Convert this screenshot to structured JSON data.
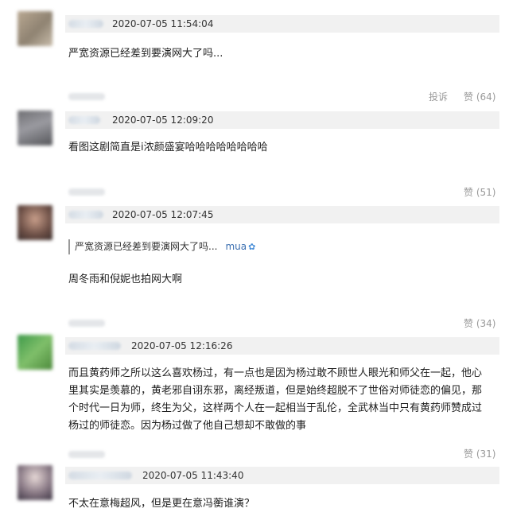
{
  "comments": [
    {
      "timestamp": "2020-07-05 11:54:04",
      "text": "严宽资源已经差到要演网大了吗...",
      "actions": {
        "report": "投诉",
        "like": "赞 (64)"
      }
    },
    {
      "timestamp": "2020-07-05 12:09:20",
      "text": "看图这剧简直是i浓颜盛宴哈哈哈哈哈哈哈哈",
      "actions": {
        "like": "赞 (51)"
      }
    },
    {
      "timestamp": "2020-07-05 12:07:45",
      "quote": {
        "text": "严宽资源已经差到要演网大了吗...",
        "name": "mua"
      },
      "text": "周冬雨和倪妮也拍网大啊",
      "actions": {
        "like": "赞 (34)"
      }
    },
    {
      "timestamp": "2020-07-05 12:16:26",
      "text_lines": [
        "而且黄药师之所以这么喜欢杨过，有一点也是因为杨过敢不顾世人眼光和师父在一起，他心",
        "里其实是羡慕的，黄老邪自诩东邪，离经叛道，但是始终超脱不了世俗对师徒恋的偏见，那",
        "个时代一日为师，终生为父，这样两个人在一起相当于乱伦，全武林当中只有黄药师赞成过",
        "杨过的师徒恋。因为杨过做了他自己想却不敢做的事"
      ],
      "actions": {
        "like": "赞 (31)"
      }
    },
    {
      "timestamp": "2020-07-05 11:43:40",
      "text": "不太在意梅超风，但是更在意冯蘅谁演？"
    }
  ]
}
